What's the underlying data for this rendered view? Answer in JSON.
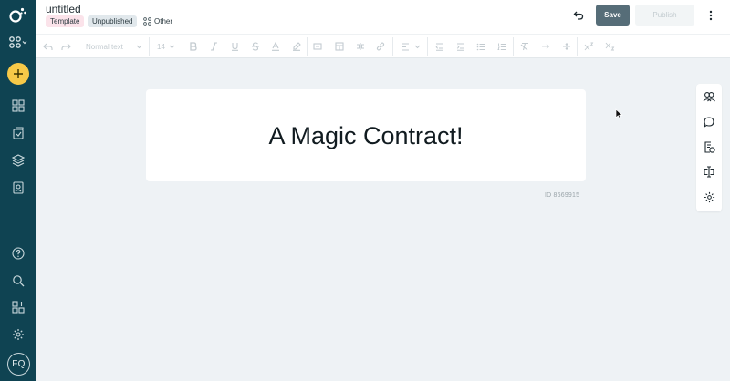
{
  "header": {
    "title": "untitled",
    "tag_template": "Template",
    "tag_status": "Unpublished",
    "tag_other": "Other",
    "save_label": "Save",
    "publish_label": "Publish"
  },
  "toolbar": {
    "text_style": "Normal text",
    "font_size": "14"
  },
  "document": {
    "heading": "A Magic Contract!",
    "id_label": "ID 8669915"
  },
  "user": {
    "initials": "FQ"
  },
  "colors": {
    "rail": "#0f4352",
    "add_button": "#f7c948",
    "save_button": "#566d78",
    "canvas": "#eef2f5"
  }
}
